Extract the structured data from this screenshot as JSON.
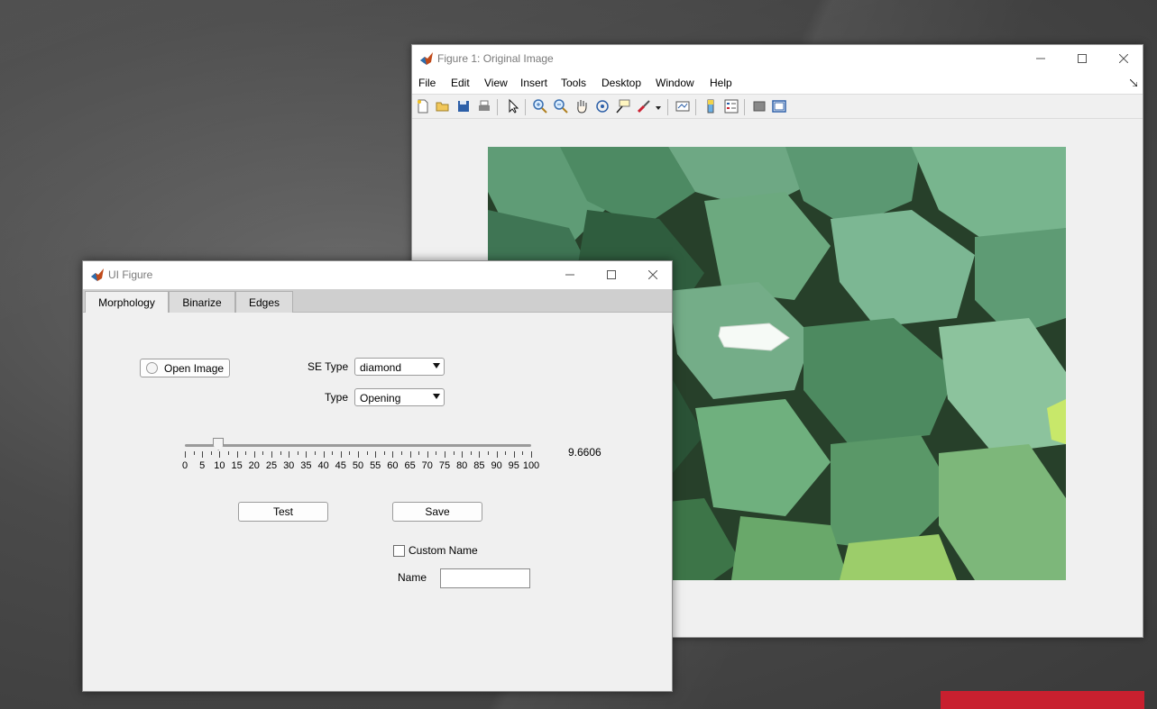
{
  "figure_window": {
    "title": "Figure 1: Original Image",
    "menu": [
      "File",
      "Edit",
      "View",
      "Insert",
      "Tools",
      "Desktop",
      "Window",
      "Help"
    ],
    "toolbar_icons": [
      "new-file-icon",
      "open-folder-icon",
      "save-icon",
      "print-icon",
      "pointer-icon",
      "zoom-in-icon",
      "zoom-out-icon",
      "pan-hand-icon",
      "rotate-3d-icon",
      "data-cursor-icon",
      "brush-icon",
      "dropdown-arrow-icon",
      "link-plot-icon",
      "colorbar-icon",
      "legend-icon",
      "hide-plot-tools-icon",
      "show-plot-tools-icon"
    ]
  },
  "ui_window": {
    "title": "UI Figure",
    "tabs": [
      "Morphology",
      "Binarize",
      "Edges"
    ],
    "active_tab": "Morphology",
    "open_image_label": "Open Image",
    "se_type_label": "SE Type",
    "se_type_value": "diamond",
    "type_label": "Type",
    "type_value": "Opening",
    "slider": {
      "value": 9.6606,
      "value_text": "9.6606",
      "min": 0,
      "max": 100,
      "tick_labels": [
        "0",
        "5",
        "10",
        "15",
        "20",
        "25",
        "30",
        "35",
        "40",
        "45",
        "50",
        "55",
        "60",
        "65",
        "70",
        "75",
        "80",
        "85",
        "90",
        "95",
        "100"
      ]
    },
    "test_label": "Test",
    "save_label": "Save",
    "custom_name_label": "Custom Name",
    "custom_name_checked": false,
    "name_label": "Name",
    "name_value": ""
  },
  "colors": {
    "accent_red": "#c8202f",
    "window_bg": "#f0f0f0"
  }
}
